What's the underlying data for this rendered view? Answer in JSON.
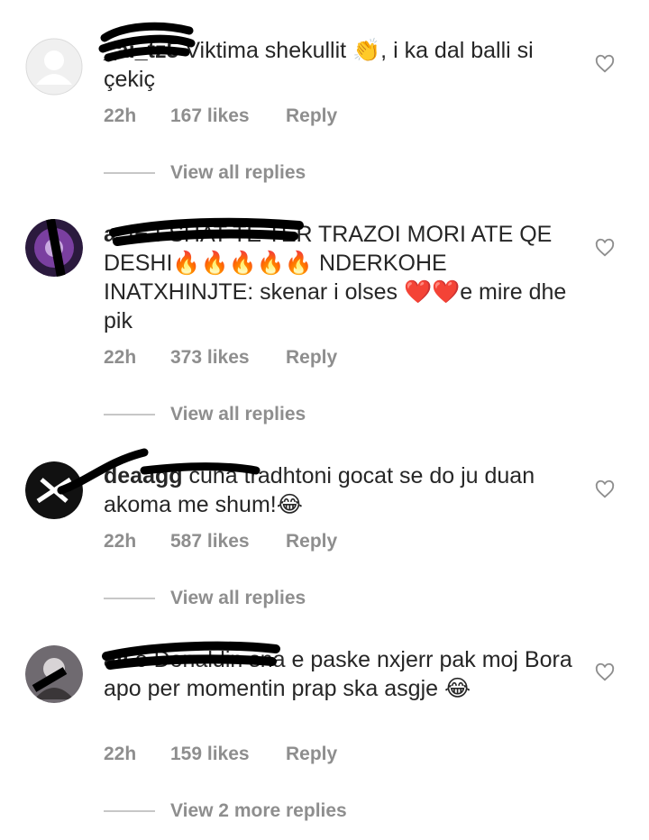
{
  "comments": [
    {
      "username": "_ai_tz5",
      "text": " Viktima shekullit 👏, i ka dal balli si çekiç",
      "time": "22h",
      "likes": "167 likes",
      "reply": "Reply",
      "replies": "View all replies"
    },
    {
      "username": "a",
      "text": " JE FSHAT TE TER TRAZOI MORI ATE QE DESHI🔥🔥🔥🔥🔥 NDERKOHE INATXHINJTE: skenar i olses ❤️❤️e mire dhe pik",
      "time": "22h",
      "likes": "373 likes",
      "reply": "Reply",
      "replies": "View all replies"
    },
    {
      "username": "deaagg",
      "text": " cuna tradhtoni gocat se do ju duan akoma me shum!😂",
      "time": "22h",
      "likes": "587 likes",
      "reply": "Reply",
      "replies": "View all replies"
    },
    {
      "username": "all",
      "text": " o Donaldin sna e paske nxjerr pak moj Bora apo per momentin  prap ska asgje 😂",
      "time": "22h",
      "likes": "159 likes",
      "reply": "Reply",
      "replies": "View 2 more replies"
    }
  ],
  "icons": {
    "like": "heart-outline-icon",
    "avatar_default": "default-avatar-icon"
  },
  "colors": {
    "text": "#262626",
    "meta": "#8e8e8e",
    "divider": "#c7c7c7"
  }
}
